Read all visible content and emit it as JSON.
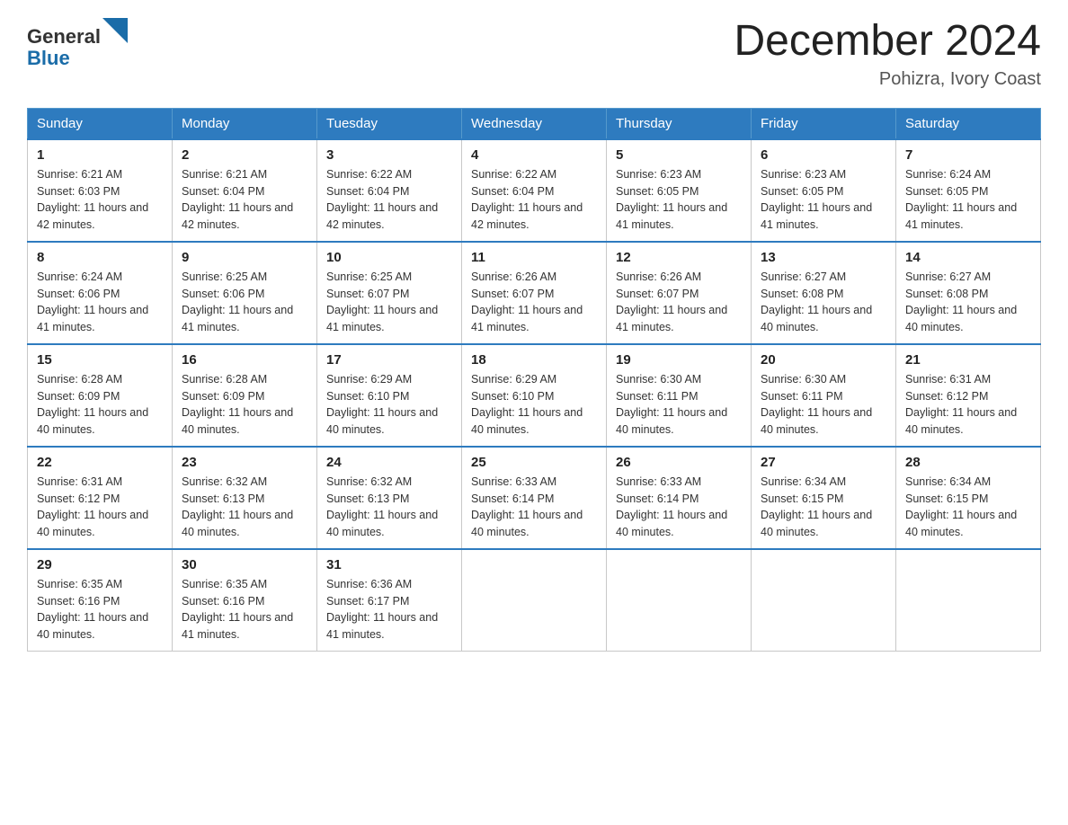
{
  "header": {
    "logo_text_general": "General",
    "logo_text_blue": "Blue",
    "month_title": "December 2024",
    "location": "Pohizra, Ivory Coast"
  },
  "weekdays": [
    "Sunday",
    "Monday",
    "Tuesday",
    "Wednesday",
    "Thursday",
    "Friday",
    "Saturday"
  ],
  "weeks": [
    [
      {
        "day": "1",
        "sunrise": "6:21 AM",
        "sunset": "6:03 PM",
        "daylight": "11 hours and 42 minutes."
      },
      {
        "day": "2",
        "sunrise": "6:21 AM",
        "sunset": "6:04 PM",
        "daylight": "11 hours and 42 minutes."
      },
      {
        "day": "3",
        "sunrise": "6:22 AM",
        "sunset": "6:04 PM",
        "daylight": "11 hours and 42 minutes."
      },
      {
        "day": "4",
        "sunrise": "6:22 AM",
        "sunset": "6:04 PM",
        "daylight": "11 hours and 42 minutes."
      },
      {
        "day": "5",
        "sunrise": "6:23 AM",
        "sunset": "6:05 PM",
        "daylight": "11 hours and 41 minutes."
      },
      {
        "day": "6",
        "sunrise": "6:23 AM",
        "sunset": "6:05 PM",
        "daylight": "11 hours and 41 minutes."
      },
      {
        "day": "7",
        "sunrise": "6:24 AM",
        "sunset": "6:05 PM",
        "daylight": "11 hours and 41 minutes."
      }
    ],
    [
      {
        "day": "8",
        "sunrise": "6:24 AM",
        "sunset": "6:06 PM",
        "daylight": "11 hours and 41 minutes."
      },
      {
        "day": "9",
        "sunrise": "6:25 AM",
        "sunset": "6:06 PM",
        "daylight": "11 hours and 41 minutes."
      },
      {
        "day": "10",
        "sunrise": "6:25 AM",
        "sunset": "6:07 PM",
        "daylight": "11 hours and 41 minutes."
      },
      {
        "day": "11",
        "sunrise": "6:26 AM",
        "sunset": "6:07 PM",
        "daylight": "11 hours and 41 minutes."
      },
      {
        "day": "12",
        "sunrise": "6:26 AM",
        "sunset": "6:07 PM",
        "daylight": "11 hours and 41 minutes."
      },
      {
        "day": "13",
        "sunrise": "6:27 AM",
        "sunset": "6:08 PM",
        "daylight": "11 hours and 40 minutes."
      },
      {
        "day": "14",
        "sunrise": "6:27 AM",
        "sunset": "6:08 PM",
        "daylight": "11 hours and 40 minutes."
      }
    ],
    [
      {
        "day": "15",
        "sunrise": "6:28 AM",
        "sunset": "6:09 PM",
        "daylight": "11 hours and 40 minutes."
      },
      {
        "day": "16",
        "sunrise": "6:28 AM",
        "sunset": "6:09 PM",
        "daylight": "11 hours and 40 minutes."
      },
      {
        "day": "17",
        "sunrise": "6:29 AM",
        "sunset": "6:10 PM",
        "daylight": "11 hours and 40 minutes."
      },
      {
        "day": "18",
        "sunrise": "6:29 AM",
        "sunset": "6:10 PM",
        "daylight": "11 hours and 40 minutes."
      },
      {
        "day": "19",
        "sunrise": "6:30 AM",
        "sunset": "6:11 PM",
        "daylight": "11 hours and 40 minutes."
      },
      {
        "day": "20",
        "sunrise": "6:30 AM",
        "sunset": "6:11 PM",
        "daylight": "11 hours and 40 minutes."
      },
      {
        "day": "21",
        "sunrise": "6:31 AM",
        "sunset": "6:12 PM",
        "daylight": "11 hours and 40 minutes."
      }
    ],
    [
      {
        "day": "22",
        "sunrise": "6:31 AM",
        "sunset": "6:12 PM",
        "daylight": "11 hours and 40 minutes."
      },
      {
        "day": "23",
        "sunrise": "6:32 AM",
        "sunset": "6:13 PM",
        "daylight": "11 hours and 40 minutes."
      },
      {
        "day": "24",
        "sunrise": "6:32 AM",
        "sunset": "6:13 PM",
        "daylight": "11 hours and 40 minutes."
      },
      {
        "day": "25",
        "sunrise": "6:33 AM",
        "sunset": "6:14 PM",
        "daylight": "11 hours and 40 minutes."
      },
      {
        "day": "26",
        "sunrise": "6:33 AM",
        "sunset": "6:14 PM",
        "daylight": "11 hours and 40 minutes."
      },
      {
        "day": "27",
        "sunrise": "6:34 AM",
        "sunset": "6:15 PM",
        "daylight": "11 hours and 40 minutes."
      },
      {
        "day": "28",
        "sunrise": "6:34 AM",
        "sunset": "6:15 PM",
        "daylight": "11 hours and 40 minutes."
      }
    ],
    [
      {
        "day": "29",
        "sunrise": "6:35 AM",
        "sunset": "6:16 PM",
        "daylight": "11 hours and 40 minutes."
      },
      {
        "day": "30",
        "sunrise": "6:35 AM",
        "sunset": "6:16 PM",
        "daylight": "11 hours and 41 minutes."
      },
      {
        "day": "31",
        "sunrise": "6:36 AM",
        "sunset": "6:17 PM",
        "daylight": "11 hours and 41 minutes."
      },
      null,
      null,
      null,
      null
    ]
  ]
}
